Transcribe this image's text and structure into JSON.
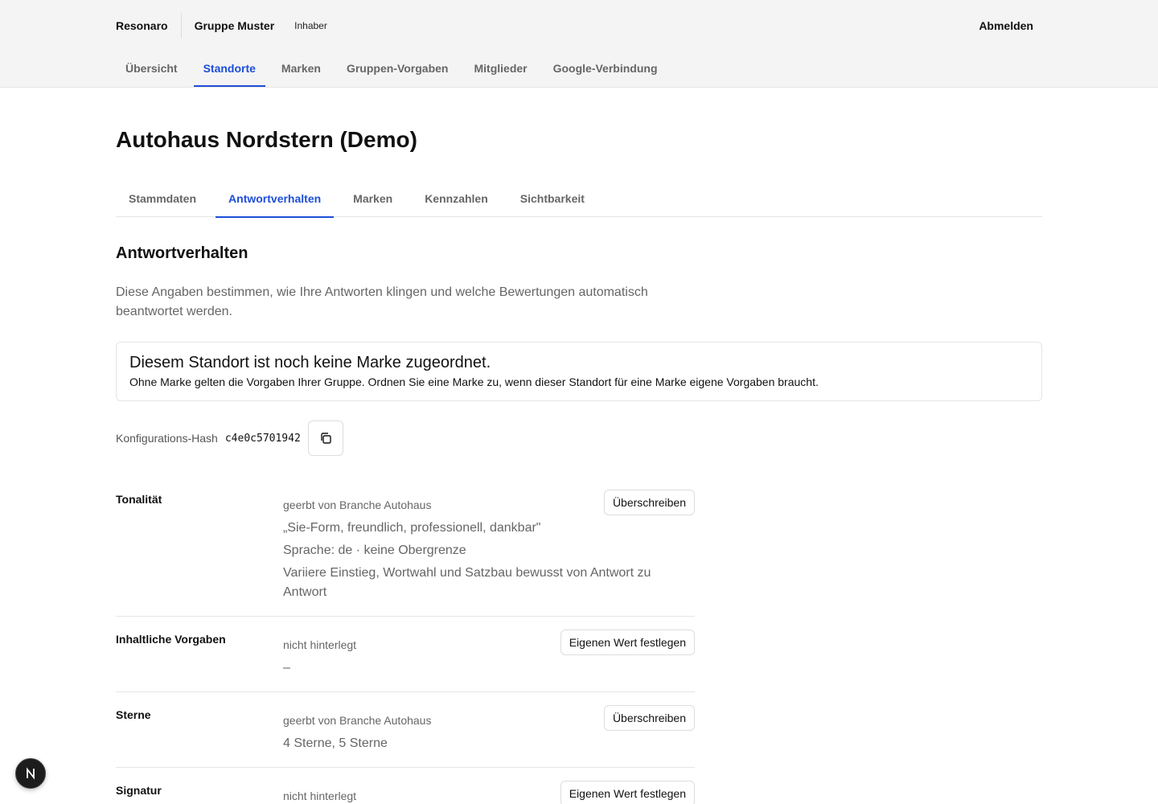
{
  "header": {
    "brand": "Resonaro",
    "group": "Gruppe Muster",
    "role": "Inhaber",
    "logout": "Abmelden"
  },
  "main_nav": [
    {
      "label": "Übersicht",
      "active": false
    },
    {
      "label": "Standorte",
      "active": true
    },
    {
      "label": "Marken",
      "active": false
    },
    {
      "label": "Gruppen-Vorgaben",
      "active": false
    },
    {
      "label": "Mitglieder",
      "active": false
    },
    {
      "label": "Google-Verbindung",
      "active": false
    }
  ],
  "page_title": "Autohaus Nordstern (Demo)",
  "sub_tabs": [
    {
      "label": "Stammdaten",
      "active": false
    },
    {
      "label": "Antwortverhalten",
      "active": true
    },
    {
      "label": "Marken",
      "active": false
    },
    {
      "label": "Kennzahlen",
      "active": false
    },
    {
      "label": "Sichtbarkeit",
      "active": false
    }
  ],
  "section": {
    "title": "Antwortverhalten",
    "description": "Diese Angaben bestimmen, wie Ihre Antworten klingen und welche Bewertungen automatisch beantwortet werden."
  },
  "notice": {
    "title": "Diesem Standort ist noch keine Marke zugeordnet.",
    "body": "Ohne Marke gelten die Vorgaben Ihrer Gruppe. Ordnen Sie eine Marke zu, wenn dieser Standort für eine Marke eigene Vorgaben braucht."
  },
  "hash": {
    "label": "Konfigurations-Hash",
    "value": "c4e0c5701942",
    "copy_icon": "copy-icon"
  },
  "settings": [
    {
      "label": "Tonalität",
      "source": "geerbt von Branche Autohaus",
      "action": "Überschreiben",
      "values": [
        "„Sie-Form, freundlich, professionell, dankbar\"",
        "Sprache: de · keine Obergrenze",
        "Variiere Einstieg, Wortwahl und Satzbau bewusst von Antwort zu Antwort"
      ]
    },
    {
      "label": "Inhaltliche Vorgaben",
      "source": "nicht hinterlegt",
      "action": "Eigenen Wert festlegen",
      "values": [
        "–"
      ]
    },
    {
      "label": "Sterne",
      "source": "geerbt von Branche Autohaus",
      "action": "Überschreiben",
      "values": [
        "4 Sterne, 5 Sterne"
      ]
    },
    {
      "label": "Signatur",
      "source": "nicht hinterlegt",
      "action": "Eigenen Wert festlegen",
      "values": []
    }
  ],
  "fab": {
    "letter": "N",
    "icon": "next-logo-icon"
  },
  "colors": {
    "accent": "#1d4ed8",
    "header_bg": "#f4f4f4",
    "muted": "#666666"
  }
}
